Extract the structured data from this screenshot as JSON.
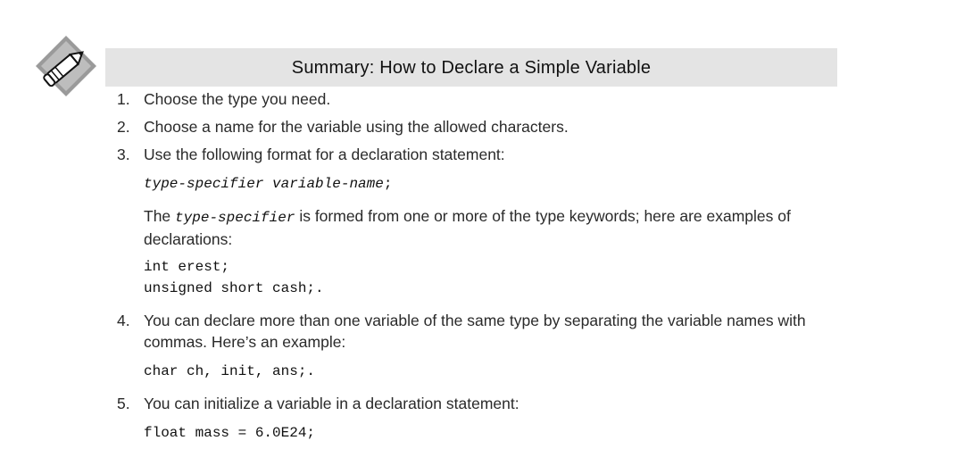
{
  "title": "Summary: How to Declare a Simple Variable",
  "icon": "pencil-icon",
  "steps": [
    {
      "num": "1.",
      "text": "Choose the type you need."
    },
    {
      "num": "2.",
      "text": "Choose a name for the variable using the allowed characters."
    },
    {
      "num": "3.",
      "text": "Use the following format for a declaration statement:"
    },
    {
      "num": "4.",
      "text": "You can declare more than one variable of the same type by separating the variable names with commas. Here’s an example:"
    },
    {
      "num": "5.",
      "text": "You can initialize a variable in a declaration statement:"
    }
  ],
  "step3": {
    "format_a": "type-specifier",
    "format_b": "variable-name",
    "format_semicolon": ";",
    "para_pre": "The ",
    "para_kw": "type-specifier",
    "para_post": " is formed from one or more of the type keywords; here are examples of declarations:",
    "example_1": "int erest;",
    "example_2": "unsigned short cash;."
  },
  "step4": {
    "example": "char ch, init, ans;."
  },
  "step5": {
    "example": "float mass = 6.0E24;"
  }
}
